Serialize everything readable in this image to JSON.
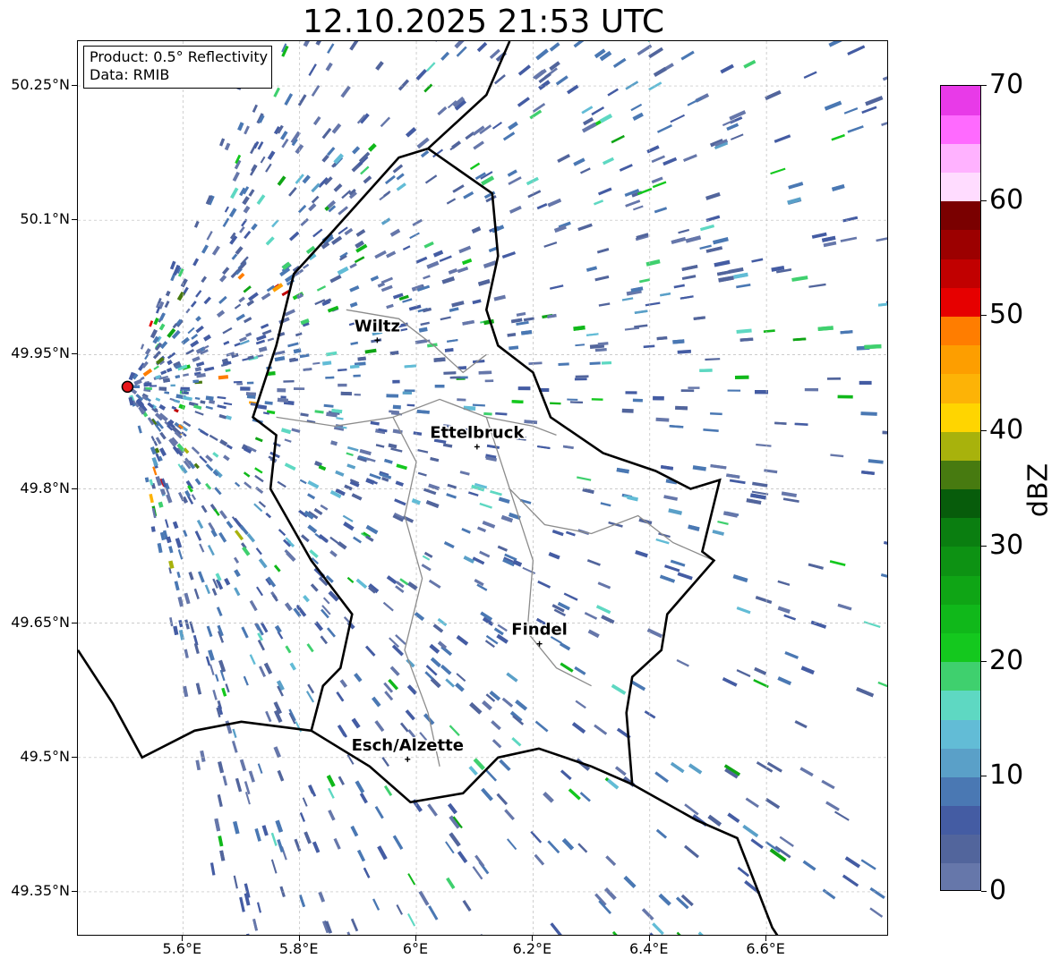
{
  "title": "12.10.2025 21:53 UTC",
  "info_box": {
    "line1": "Product: 0.5° Reflectivity",
    "line2": "Data: RMIB"
  },
  "map": {
    "lon_range": [
      5.42,
      6.81
    ],
    "lat_range": [
      49.3,
      50.3
    ],
    "lat_ticks": [
      {
        "value": 50.25,
        "label": "50.25°N"
      },
      {
        "value": 50.1,
        "label": "50.1°N"
      },
      {
        "value": 49.95,
        "label": "49.95°N"
      },
      {
        "value": 49.8,
        "label": "49.8°N"
      },
      {
        "value": 49.65,
        "label": "49.65°N"
      },
      {
        "value": 49.5,
        "label": "49.5°N"
      },
      {
        "value": 49.35,
        "label": "49.35°N"
      }
    ],
    "lon_ticks": [
      {
        "value": 5.6,
        "label": "5.6°E"
      },
      {
        "value": 5.8,
        "label": "5.8°E"
      },
      {
        "value": 6.0,
        "label": "6°E"
      },
      {
        "value": 6.2,
        "label": "6.2°E"
      },
      {
        "value": 6.4,
        "label": "6.4°E"
      },
      {
        "value": 6.6,
        "label": "6.6°E"
      }
    ],
    "gridlines": true,
    "radar_site": {
      "lon": 5.505,
      "lat": 49.914,
      "marker_color": "#e8161b"
    },
    "cities": [
      {
        "name": "Wiltz",
        "lon": 5.933,
        "lat": 49.966
      },
      {
        "name": "Ettelbruck",
        "lon": 6.104,
        "lat": 49.847
      },
      {
        "name": "Findel",
        "lon": 6.211,
        "lat": 49.627
      },
      {
        "name": "Esch/Alzette",
        "lon": 5.985,
        "lat": 49.498
      }
    ],
    "colors": {
      "border": "#000000",
      "canton_lines": "#8c8c8c",
      "gridline": "#bbbbbb"
    }
  },
  "colorbar": {
    "label": "dBZ",
    "min": 0,
    "max": 70,
    "ticks": [
      "0",
      "10",
      "20",
      "30",
      "40",
      "50",
      "60",
      "70"
    ],
    "colors": [
      "#6677aa",
      "#52659c",
      "#445ca3",
      "#4a78b3",
      "#5aa0c8",
      "#62bcd6",
      "#5ed8c2",
      "#3fd06e",
      "#14c81e",
      "#10b81a",
      "#0fa515",
      "#0d9213",
      "#0a7e10",
      "#075c0b",
      "#477a10",
      "#a8b20c",
      "#ffd500",
      "#fdb306",
      "#fd9e00",
      "#ff7d00",
      "#e60000",
      "#c10000",
      "#9c0000",
      "#7a0000",
      "#ffdcff",
      "#ffb2ff",
      "#ff6aff",
      "#e83ae8"
    ]
  }
}
